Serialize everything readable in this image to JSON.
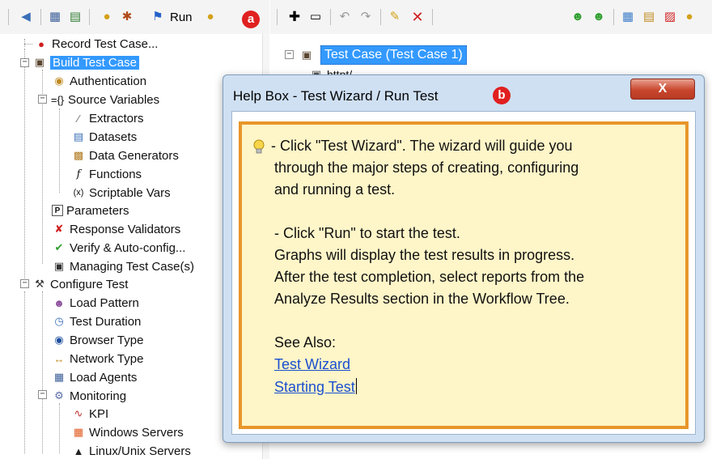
{
  "left_toolbar": {
    "run_label": "Run",
    "badge": "a"
  },
  "tree": {
    "items": [
      {
        "label": "Record Test Case..."
      },
      {
        "label": "Build Test Case"
      },
      {
        "label": "Authentication"
      },
      {
        "label": "Source Variables"
      },
      {
        "label": "Extractors"
      },
      {
        "label": "Datasets"
      },
      {
        "label": "Data Generators"
      },
      {
        "label": "Functions"
      },
      {
        "label": "Scriptable Vars"
      },
      {
        "label": "Parameters"
      },
      {
        "label": "Response Validators"
      },
      {
        "label": "Verify & Auto-config..."
      },
      {
        "label": "Managing Test Case(s)"
      },
      {
        "label": "Configure Test"
      },
      {
        "label": "Load Pattern"
      },
      {
        "label": "Test Duration"
      },
      {
        "label": "Browser Type"
      },
      {
        "label": "Network Type"
      },
      {
        "label": "Load Agents"
      },
      {
        "label": "Monitoring"
      },
      {
        "label": "KPI"
      },
      {
        "label": "Windows Servers"
      },
      {
        "label": "Linux/Unix Servers"
      }
    ]
  },
  "right_tree": {
    "test_case_label": "Test Case (Test Case 1)",
    "child_label": "httpt/"
  },
  "dialog": {
    "title": "Help Box - Test Wizard / Run Test",
    "badge": "b",
    "close_label": "X",
    "lines": [
      "- Click \"Test Wizard\". The wizard will guide you",
      "through the major steps of creating, configuring",
      "and running a test.",
      "- Click \"Run\" to start the test.",
      "Graphs will display the test results in progress.",
      "After the test completion, select reports from the",
      "Analyze Results section in the Workflow Tree.",
      "See Also:"
    ],
    "links": [
      "Test Wizard",
      "Starting Test"
    ]
  },
  "icons": {
    "bulb": "lightbulb-icon",
    "run": "run-flag-icon"
  },
  "colors": {
    "selection": "#3399ff",
    "help_border": "#e8962a",
    "help_background": "#fef5c8",
    "badge": "#e02020",
    "link": "#1a4fd0"
  }
}
